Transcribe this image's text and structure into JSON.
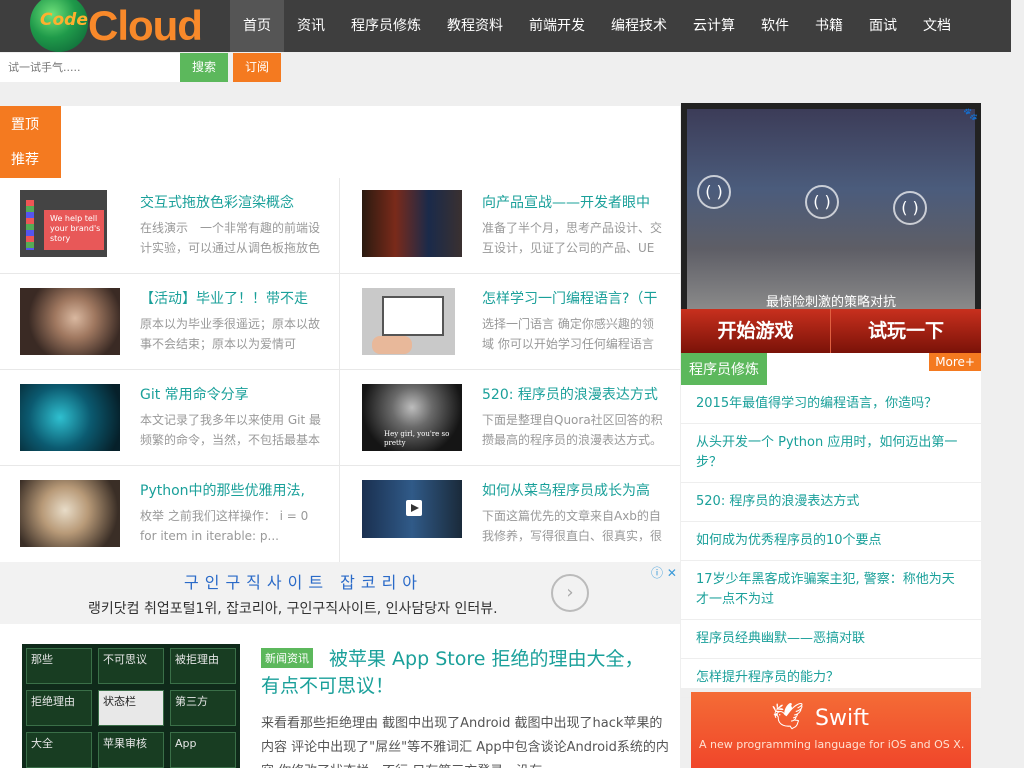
{
  "header": {
    "logo_text_small": "Code",
    "logo_text": "Cloud",
    "nav": [
      "首页",
      "资讯",
      "程序员修炼",
      "教程资料",
      "前端开发",
      "编程技术",
      "云计算",
      "软件",
      "书籍",
      "面试",
      "文档"
    ]
  },
  "search": {
    "placeholder": "试一试手气.....",
    "search_label": "搜索",
    "subscribe_label": "订阅"
  },
  "pinned": {
    "label_line1": "置顶",
    "label_line2": "推荐"
  },
  "cards": [
    {
      "title": "交互式拖放色彩渲染概念",
      "desc": "在线演示　一个非常有趣的前端设计实验，可以通过从调色板拖放色"
    },
    {
      "title": "向产品宣战——开发者眼中",
      "desc": "准备了半个月，思考产品设计、交互设计，见证了公司的产品、UE"
    },
    {
      "title": "【活动】毕业了！！带不走",
      "desc": "原本以为毕业季很遥远；原本以故事不会结束；原本以为爱情可"
    },
    {
      "title": "怎样学习一门编程语言?（干",
      "desc": "选择一门语言 确定你感兴趣的领域 你可以开始学习任何编程语言"
    },
    {
      "title": "Git 常用命令分享",
      "desc": "本文记录了我多年以来使用 Git 最频繁的命令，当然，不包括最基本"
    },
    {
      "title": "520: 程序员的浪漫表达方式",
      "desc": "下面是整理自Quora社区回答的积攒最高的程序员的浪漫表达方式。"
    },
    {
      "title": "Python中的那些优雅用法,",
      "desc": "枚举 之前我们这样操作： i = 0 for item in iterable: p..."
    },
    {
      "title": "如何从菜鸟程序员成长为高",
      "desc": "下面这篇优先的文章来自Axb的自我修养，写得很直白、很真实，很"
    }
  ],
  "thumb_texts": {
    "t1": "We help tell your brand's story",
    "t6": "Hey girl, you're so pretty"
  },
  "ad_strip": {
    "title": "구인구직사이트 잡코리아",
    "subtitle": "랭키닷컴 취업포털1위, 잡코리아, 구인구직사이트, 인사담당자 인터뷰.",
    "badge": "ⓘ ✕"
  },
  "featured": {
    "tag": "新闻资讯",
    "title": "被苹果 App Store 拒绝的理由大全，有点不可思议！",
    "desc": "来看看那些拒绝理由 截图中出现了Android 截图中出现了hack苹果的内容 评论中出现了\"屌丝\"等不雅词汇 App中包含谈论Android系统的内容 你修改了状态栏　不行 只有第三方登录，没有"
  },
  "thumb_cells": [
    "那些",
    "不可思议",
    "被拒理由",
    "拒绝理由",
    "状态栏",
    "第三方",
    "大全",
    "苹果审核",
    "App"
  ],
  "game_ad": {
    "caption": "最惊险刺激的策略对抗",
    "start": "开始游戏",
    "try": "试玩一下"
  },
  "sidebar": {
    "title": "程序员修炼",
    "more": "More+",
    "links": [
      "2015年最值得学习的编程语言，你造吗？",
      "从头开发一个 Python 应用时，如何迈出第一步？",
      "520: 程序员的浪漫表达方式",
      "如何成为优秀程序员的10个要点",
      "17岁少年黑客成诈骗案主犯, 警察：称他为天才一点不为过",
      "程序员经典幽默——恶搞对联",
      "怎样提升程序员的能力？"
    ]
  },
  "swift_ad": {
    "brand": "Swift",
    "tagline": "A new programming language for iOS and OS X."
  }
}
